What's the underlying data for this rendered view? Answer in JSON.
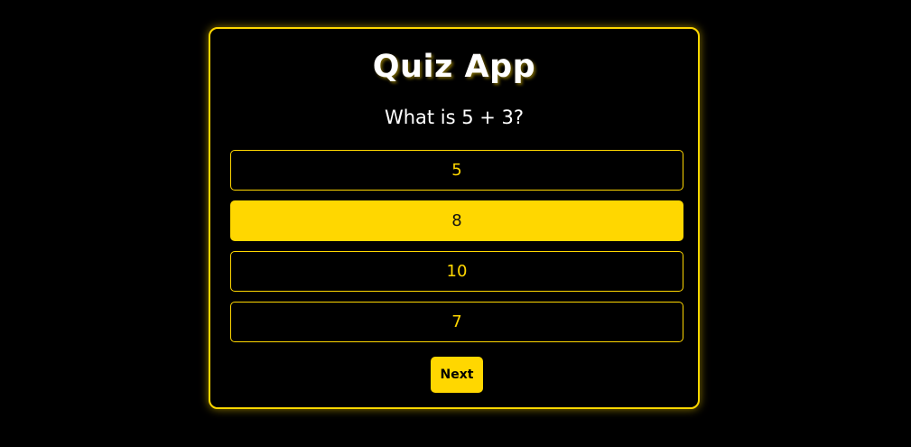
{
  "quiz": {
    "title": "Quiz App",
    "question": "What is 5 + 3?",
    "options": [
      {
        "label": "5",
        "selected": false
      },
      {
        "label": "8",
        "selected": true
      },
      {
        "label": "10",
        "selected": false
      },
      {
        "label": "7",
        "selected": false
      }
    ],
    "next_label": "Next"
  },
  "colors": {
    "background": "#000000",
    "accent": "#ffd700",
    "text": "#ffffff",
    "selected_text": "#111111"
  }
}
